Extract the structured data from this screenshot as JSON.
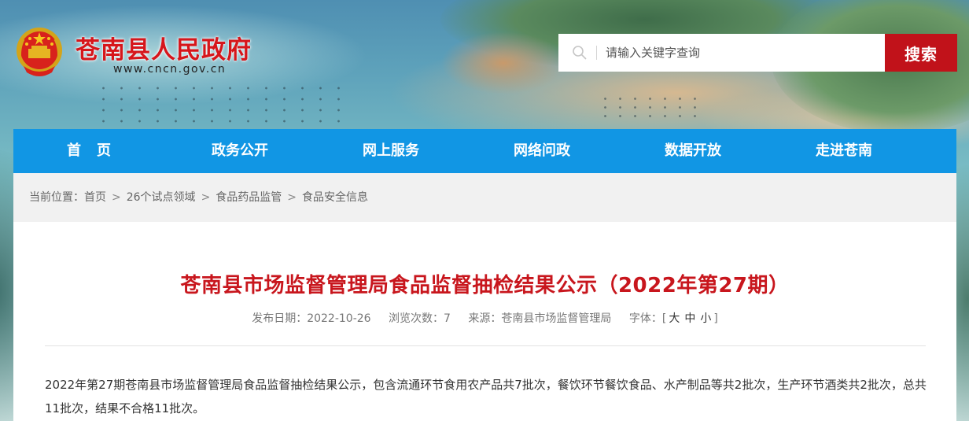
{
  "header": {
    "site_name": "苍南县人民政府",
    "site_url": "www.cncn.gov.cn"
  },
  "search": {
    "placeholder": "请输入关键字查询",
    "button_label": "搜索"
  },
  "nav": {
    "items": [
      "首页",
      "政务公开",
      "网上服务",
      "网络问政",
      "数据开放",
      "走进苍南"
    ]
  },
  "breadcrumb": {
    "prefix": "当前位置：",
    "items": [
      "首页",
      "26个试点领域",
      "食品药品监管",
      "食品安全信息"
    ],
    "separator": ">"
  },
  "article": {
    "title": "苍南县市场监督管理局食品监督抽检结果公示（2022年第27期）",
    "publish_date": "发布日期：2022-10-26",
    "views": "浏览次数：7",
    "source": "来源：苍南县市场监督管理局",
    "font_size_label": "字体：[",
    "font_size_large": "大",
    "font_size_medium": "中",
    "font_size_small": "小",
    "font_size_close": "]",
    "body": "2022年第27期苍南县市场监督管理局食品监督抽检结果公示，包含流通环节食用农产品共7批次，餐饮环节餐饮食品、水产制品等共2批次，生产环节酒类共2批次，总共11批次，结果不合格11批次。"
  },
  "colors": {
    "brand_red": "#c1121a",
    "title_red": "#c8161d",
    "nav_blue": "#1196e4"
  }
}
